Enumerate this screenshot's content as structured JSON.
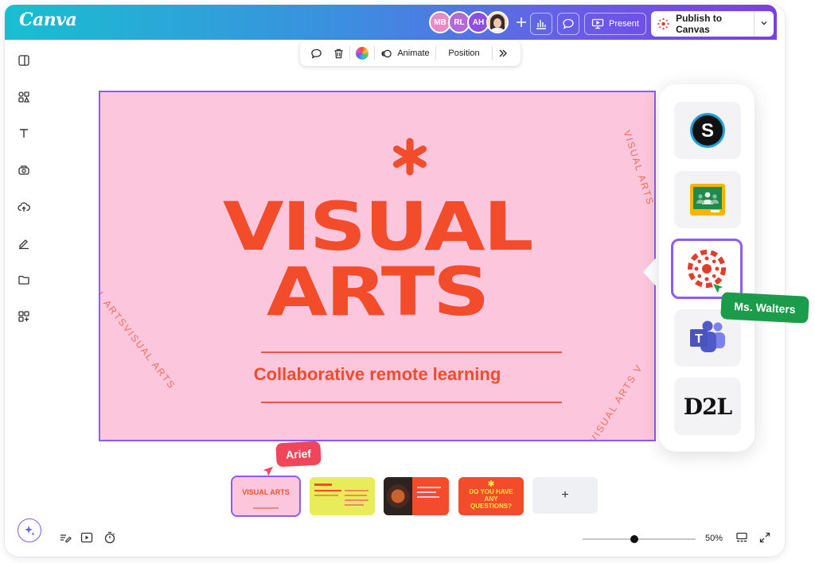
{
  "app": {
    "logo": "Canva",
    "brand_gradient": [
      "#18bfd0",
      "#7b3fe4"
    ]
  },
  "header": {
    "collaborators": [
      {
        "initials": "MB",
        "color": "#e889c8"
      },
      {
        "initials": "RL",
        "color": "#b36ad6"
      },
      {
        "initials": "AH",
        "color": "#8d4fe0"
      },
      {
        "initials": "",
        "color": "#f3d7c6"
      }
    ],
    "present_label": "Present",
    "publish_label": "Publish to Canvas"
  },
  "sidebar": {
    "items": [
      "layout-icon",
      "elements-icon",
      "text-icon",
      "brand-icon",
      "uploads-icon",
      "draw-icon",
      "folder-icon",
      "apps-icon"
    ]
  },
  "toolbar": {
    "animate_label": "Animate",
    "position_label": "Position"
  },
  "slide": {
    "title_line1": "VISUAL",
    "title_line2": "ARTS",
    "subtitle": "Collaborative remote learning",
    "rotated_left": "VISUAL ARTSVISUAL ARTS",
    "rotated_right_top": "VISUAL ARTS",
    "rotated_right_bottom": "VISUAL ARTS V",
    "accent_color": "#f24c2a",
    "background_color": "#fcc6dd"
  },
  "integrations": {
    "items": [
      {
        "name": "Schoology",
        "glyph": "S"
      },
      {
        "name": "Google Classroom",
        "glyph": ""
      },
      {
        "name": "Canvas",
        "glyph": "",
        "selected": true
      },
      {
        "name": "Microsoft Teams",
        "glyph": "T"
      },
      {
        "name": "D2L",
        "glyph": "D2L"
      }
    ]
  },
  "cursors": {
    "walters_label": "Ms. Walters",
    "arief_label": "Arief"
  },
  "pages": {
    "thumbs": [
      {
        "title": "VISUAL ARTS",
        "bg": "#fcc6dd",
        "selected": true
      },
      {
        "title": "",
        "bg": "#e9ec5a"
      },
      {
        "title": "",
        "bg": "#f24c2a"
      },
      {
        "title": "DO YOU HAVE ANY QUESTIONS?",
        "bg": "#f24c2a"
      }
    ],
    "add_label": "+"
  },
  "footer": {
    "zoom": "50%",
    "zoom_fraction": 0.46
  }
}
